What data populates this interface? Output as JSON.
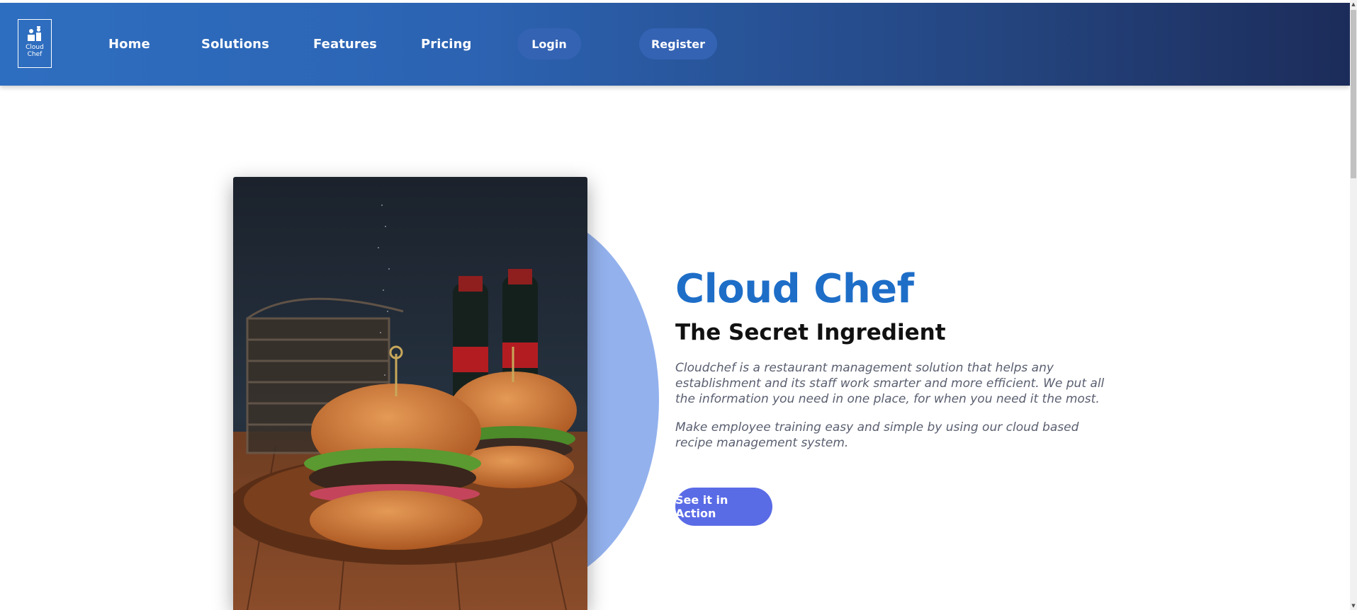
{
  "brand": {
    "logo_text": "Cloud\nChef",
    "logo_icon": "chef-icon"
  },
  "nav": {
    "items": [
      {
        "label": "Home"
      },
      {
        "label": "Solutions"
      },
      {
        "label": "Features"
      },
      {
        "label": "Pricing"
      }
    ],
    "login_label": "Login",
    "register_label": "Register"
  },
  "hero": {
    "title": "Cloud Chef",
    "subtitle": "The Secret Ingredient",
    "paragraph_1": "Cloudchef is a restaurant management solution that helps any establishment and its staff work smarter and more efficient. We put all the information you need in one place, for when you need it the most.",
    "paragraph_2": "Make employee training easy and simple by using our cloud based recipe management system.",
    "cta_label": "See it in Action",
    "image_icon": "burger-photo"
  },
  "colors": {
    "nav_gradient_start": "#2e6ec0",
    "nav_gradient_end": "#1c2c5a",
    "title": "#1e6ec8",
    "button": "#3463b4",
    "cta": "#5a6be6",
    "accent_circle": "#93b1ed"
  }
}
